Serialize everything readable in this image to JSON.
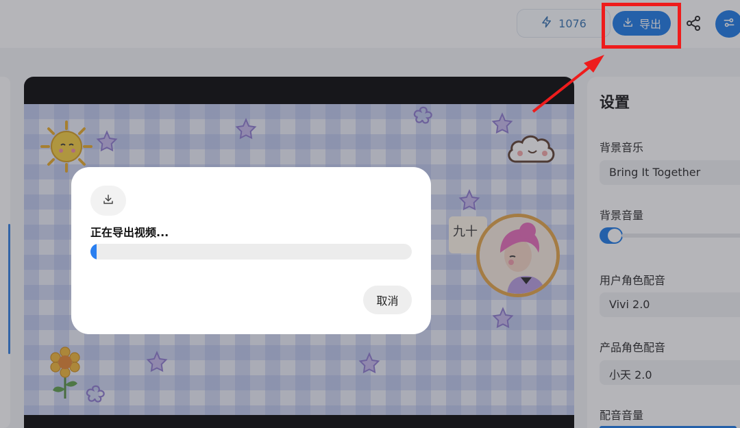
{
  "topbar": {
    "credits_value": "1076",
    "export_label": "导出"
  },
  "canvas": {
    "bubble_text": "九十"
  },
  "settings": {
    "title": "设置",
    "bgm_label": "背景音乐",
    "bgm_value": "Bring It Together",
    "bg_volume_label": "背景音量",
    "user_voice_label": "用户角色配音",
    "user_voice_value": "Vivi 2.0",
    "product_voice_label": "产品角色配音",
    "product_voice_value": "小天 2.0",
    "dub_volume_label": "配音音量"
  },
  "export_dialog": {
    "title": "正在导出视频...",
    "progress_fraction": 0.02,
    "cancel_label": "取消"
  },
  "colors": {
    "accent": "#1677e6",
    "annotation": "#ee1c1c"
  },
  "icons": [
    "bolt-icon",
    "download-icon",
    "share-icon",
    "sliders-icon"
  ]
}
